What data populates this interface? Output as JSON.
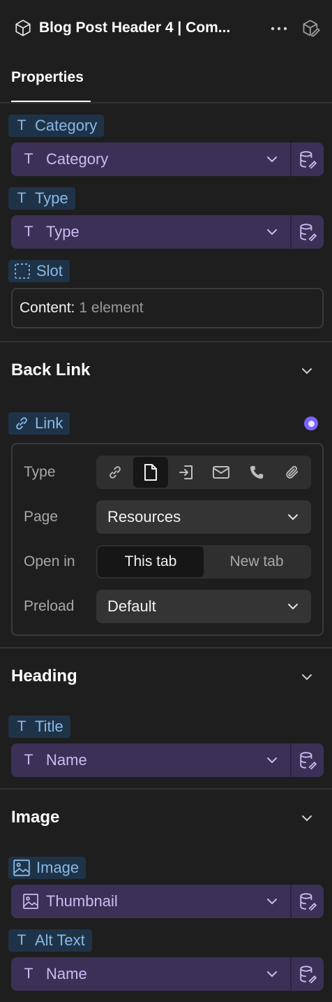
{
  "header": {
    "title": "Blog Post Header 4 | Com...",
    "icon": "cube-icon",
    "more_icon": "more-horizontal-icon",
    "right_icon": "cube-edit-icon"
  },
  "tabs": {
    "properties": "Properties"
  },
  "fields_top": {
    "category": {
      "tag": "Category",
      "value": "Category"
    },
    "type": {
      "tag": "Type",
      "value": "Type"
    },
    "slot": {
      "tag": "Slot",
      "content_key": "Content:",
      "content_value": "1 element"
    }
  },
  "back_link": {
    "title": "Back Link",
    "link_tag": "Link",
    "rows": {
      "type_label": "Type",
      "page_label": "Page",
      "page_value": "Resources",
      "open_in_label": "Open in",
      "open_this": "This tab",
      "open_new": "New tab",
      "preload_label": "Preload",
      "preload_value": "Default"
    },
    "type_options": [
      "link-icon",
      "page-icon",
      "enter-icon",
      "mail-icon",
      "phone-icon",
      "attachment-icon"
    ],
    "type_selected": "page-icon",
    "open_selected": "This tab"
  },
  "heading": {
    "title": "Heading",
    "title_tag": "Title",
    "title_value": "Name"
  },
  "image": {
    "title": "Image",
    "image_tag": "Image",
    "image_value": "Thumbnail",
    "alt_tag": "Alt Text",
    "alt_value": "Name"
  },
  "colors": {
    "background": "#1e1e1e",
    "bound_field": "#3b3157",
    "tag_bg": "#1f3348",
    "tag_text": "#8ab8e4",
    "accent": "#7b61ff"
  }
}
